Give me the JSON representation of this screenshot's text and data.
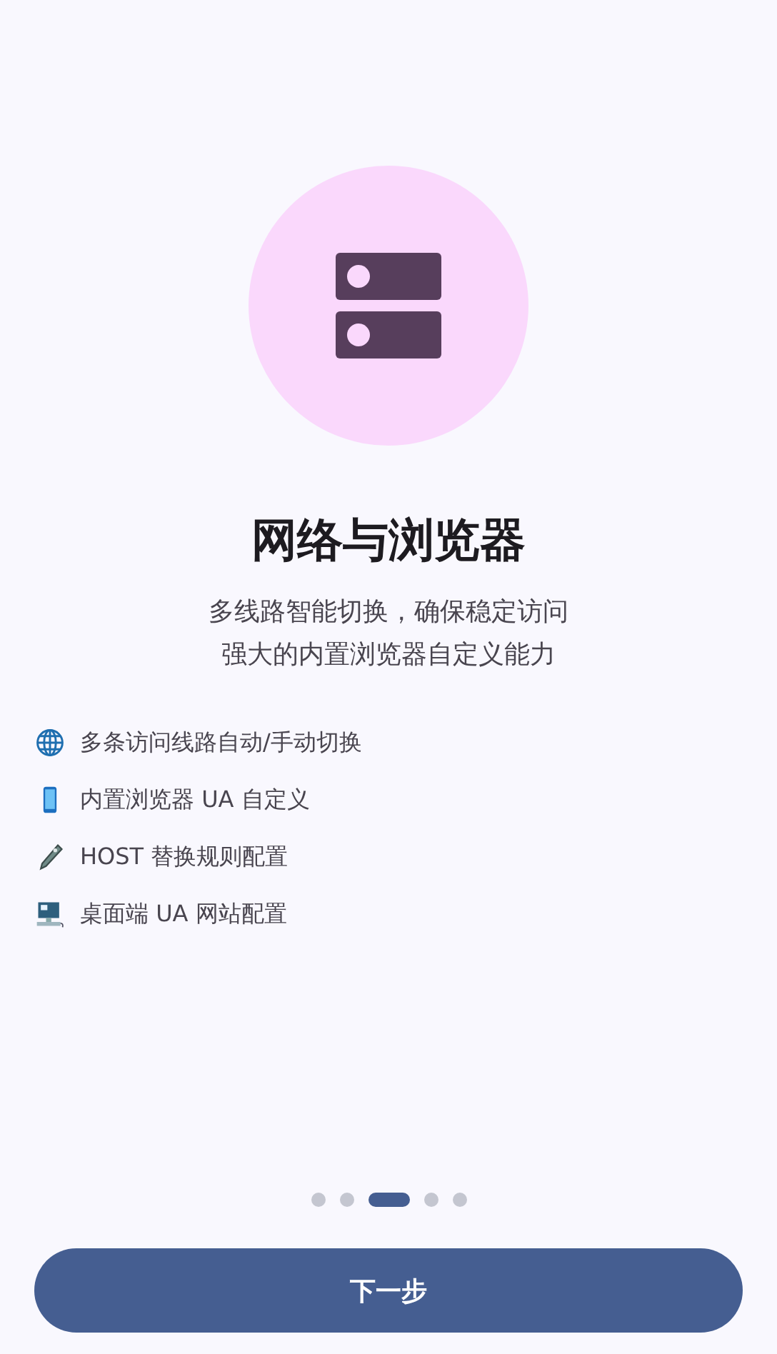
{
  "title": "网络与浏览器",
  "description": [
    "多线路智能切换，确保稳定访问",
    "强大的内置浏览器自定义能力"
  ],
  "features": [
    {
      "kind": "globe",
      "text": "多条访问线路自动/手动切换"
    },
    {
      "kind": "phone",
      "text": "内置浏览器 UA 自定义"
    },
    {
      "kind": "tool",
      "text": "HOST 替换规则配置"
    },
    {
      "kind": "computer",
      "text": "桌面端 UA 网站配置"
    }
  ],
  "pager": [
    {
      "selected": false
    },
    {
      "selected": false
    },
    {
      "selected": true
    },
    {
      "selected": false
    },
    {
      "selected": false
    }
  ],
  "next_button": "下一步"
}
